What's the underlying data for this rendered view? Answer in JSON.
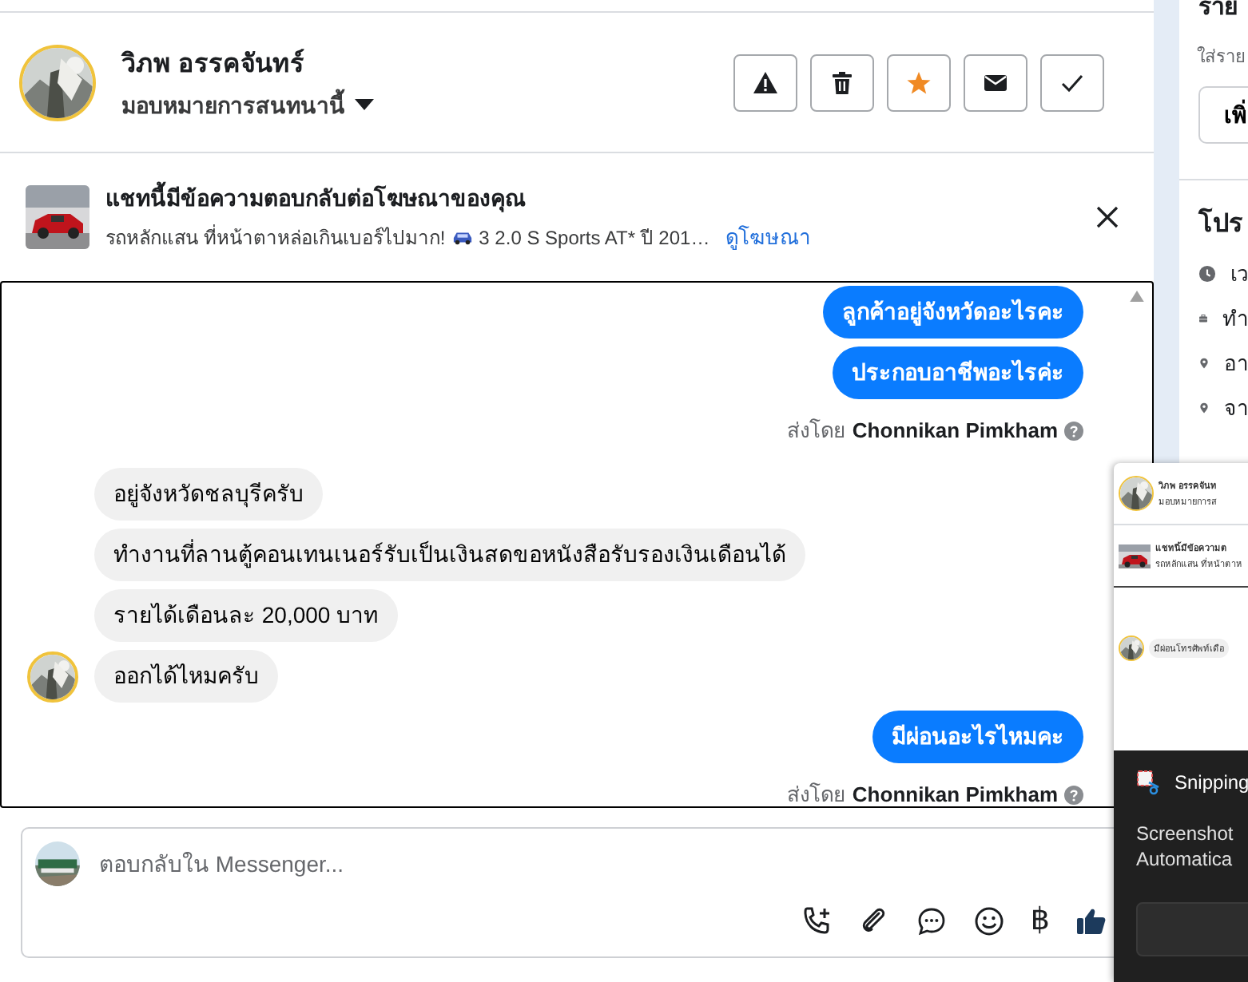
{
  "header": {
    "name": "วิภพ อรรคจันทร์",
    "assign": "มอบหมายการสนทนานี้",
    "actions": [
      {
        "kind": "report",
        "on": false
      },
      {
        "kind": "delete",
        "on": false
      },
      {
        "kind": "star",
        "on": true
      },
      {
        "kind": "mail",
        "on": false
      },
      {
        "kind": "done",
        "on": false
      }
    ]
  },
  "ad": {
    "title": "แชทนี้มีข้อความตอบกลับต่อโฆษณาของคุณ",
    "subtitle_before": "รถหลักแสน ที่หน้าตาหล่อเกินเบอร์ไปมาก!",
    "subtitle_after": "3 2.0 S Sports AT* ปี 201…",
    "link": "ดูโฆษณา"
  },
  "messages": [
    {
      "kind": "out",
      "text": "ลูกค้าอยู่จังหวัดอะไรคะ"
    },
    {
      "kind": "out",
      "text": "ประกอบอาชีพอะไรค่ะ"
    },
    {
      "kind": "sent_by",
      "prefix": "ส่งโดย",
      "name": "Chonnikan Pimkham"
    },
    {
      "kind": "in",
      "text": "อยู่จังหวัดชลบุรีครับ",
      "avatar": false
    },
    {
      "kind": "in",
      "text": "ทำงานที่ลานตู้คอนเทนเนอร์รับเป็นเงินสดขอหนังสือรับรองเงินเดือนได้",
      "avatar": false
    },
    {
      "kind": "in",
      "text": "รายได้เดือนละ 20,000 บาท",
      "avatar": false
    },
    {
      "kind": "in",
      "text": "ออกได้ไหมครับ",
      "avatar": true
    },
    {
      "kind": "out",
      "text": "มีผ่อนอะไรไหมคะ"
    },
    {
      "kind": "sent_by",
      "prefix": "ส่งโดย",
      "name": "Chonnikan Pimkham"
    }
  ],
  "composer": {
    "placeholder": "ตอบกลับใน Messenger...",
    "tools": [
      {
        "kind": "call"
      },
      {
        "kind": "attach"
      },
      {
        "kind": "chat"
      },
      {
        "kind": "emoji"
      },
      {
        "kind": "char",
        "text": "฿"
      },
      {
        "kind": "like"
      }
    ]
  },
  "side_panel": {
    "title": "ราย",
    "hint": "ใส่ราย",
    "button": "เพิ่",
    "section": "โปร",
    "rows": [
      {
        "kind": "clock",
        "text": "เว"
      },
      {
        "kind": "briefcase",
        "text": "ทำ"
      },
      {
        "kind": "pin",
        "text": "อา"
      },
      {
        "kind": "pin",
        "text": "จา"
      }
    ]
  },
  "notification": {
    "preview": {
      "name": "วิภพ อรรคจันท",
      "assign": "มอบหมายการส",
      "ad_title": "แชทนี้มีข้อความต",
      "ad_sub": "รถหลักแสน ที่หน้าตาห",
      "message": "มีผ่อนโทรศัพท์เดือ"
    },
    "app": "Snipping",
    "lines": [
      "Screenshot",
      "Automatica"
    ]
  }
}
